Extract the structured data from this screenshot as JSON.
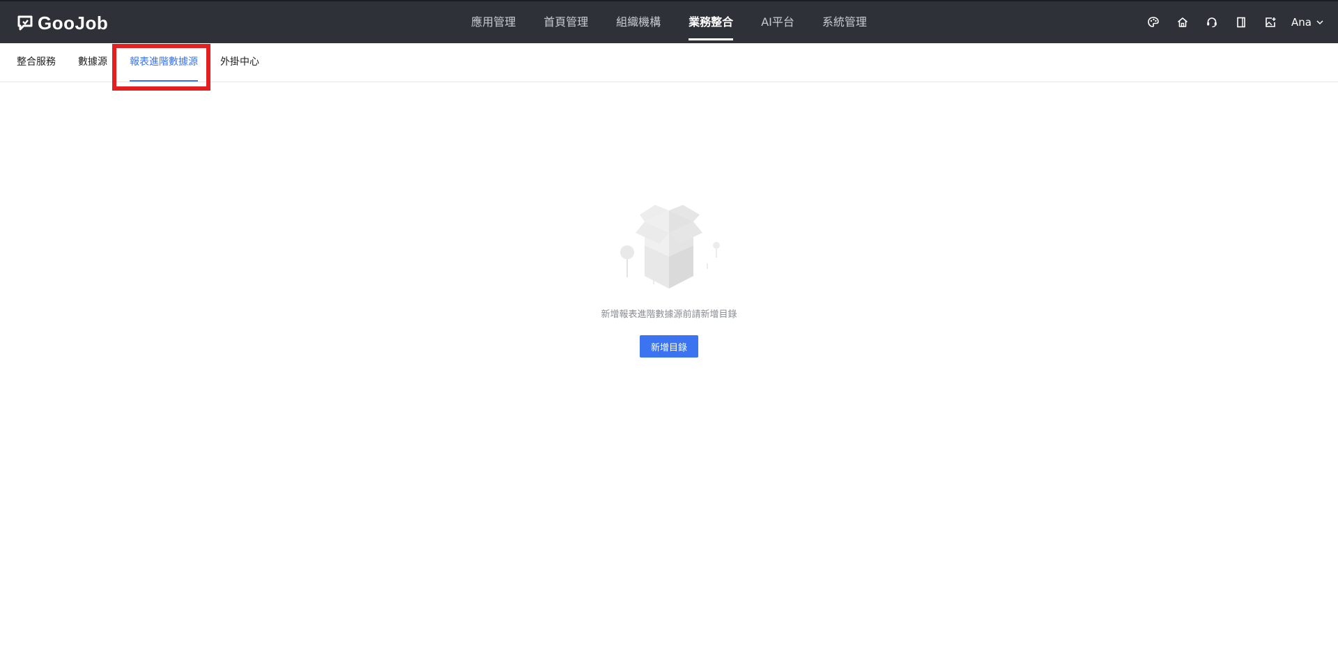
{
  "app": {
    "logo_text": "GooJob"
  },
  "main_nav": {
    "items": [
      {
        "label": "應用管理",
        "active": false
      },
      {
        "label": "首頁管理",
        "active": false
      },
      {
        "label": "組織機構",
        "active": false
      },
      {
        "label": "業務整合",
        "active": true
      },
      {
        "label": "AI平台",
        "active": false
      },
      {
        "label": "系統管理",
        "active": false
      }
    ]
  },
  "top_right": {
    "icons": [
      "palette-icon",
      "home-icon",
      "headset-icon",
      "book-icon",
      "image-add-icon"
    ],
    "user_name": "Ana"
  },
  "sub_tabs": {
    "items": [
      {
        "label": "整合服務",
        "active": false
      },
      {
        "label": "數據源",
        "active": false
      },
      {
        "label": "報表進階數據源",
        "active": true
      },
      {
        "label": "外掛中心",
        "active": false
      }
    ]
  },
  "empty_state": {
    "message": "新增報表進階數據源前請新增目錄",
    "button_label": "新增目錄"
  },
  "colors": {
    "topbar_bg": "#2e3138",
    "accent": "#3b73f0",
    "highlight": "#e51f1f"
  }
}
